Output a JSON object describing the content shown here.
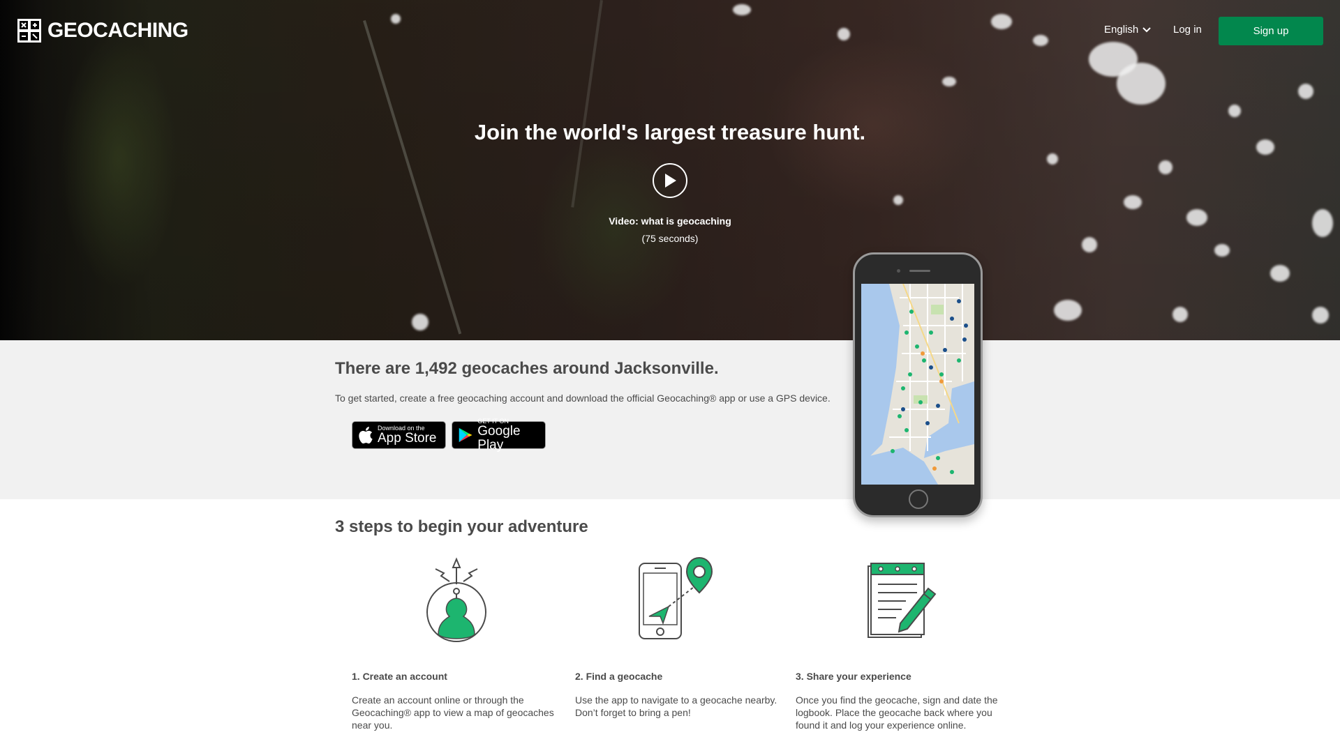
{
  "brand": {
    "name": "GEOCACHING"
  },
  "header": {
    "language": "English",
    "login": "Log in",
    "signup": "Sign up"
  },
  "hero": {
    "title": "Join the world's largest treasure hunt.",
    "video_label": "Video: what is geocaching",
    "video_duration": "(75 seconds)"
  },
  "info": {
    "count_heading": "There are 1,492 geocaches around Jacksonville.",
    "subtext": "To get started, create a free geocaching account and download the official Geocaching® app or use a GPS device.",
    "app_store": {
      "small": "Download on the",
      "big": "App Store"
    },
    "google_play": {
      "small": "GET IT ON",
      "big": "Google Play"
    }
  },
  "steps": {
    "heading": "3 steps to begin your adventure",
    "items": [
      {
        "title": "1. Create an account",
        "lines": [
          "Create an account online or through the",
          "Geocaching® app to view a map of geocaches",
          "near you."
        ]
      },
      {
        "title": "2. Find a geocache",
        "lines": [
          "Use the app to navigate to a geocache nearby.",
          "Don’t forget to bring a pen!"
        ]
      },
      {
        "title": "3. Share your experience",
        "lines": [
          "Once you find the geocache, sign and date the",
          "logbook. Place the geocache back where you",
          "found it and log your experience online."
        ]
      }
    ]
  },
  "colors": {
    "brand_green": "#02874d",
    "icon_green": "#1db56f",
    "text": "#4a4a4a",
    "band": "#f1f1f1"
  }
}
